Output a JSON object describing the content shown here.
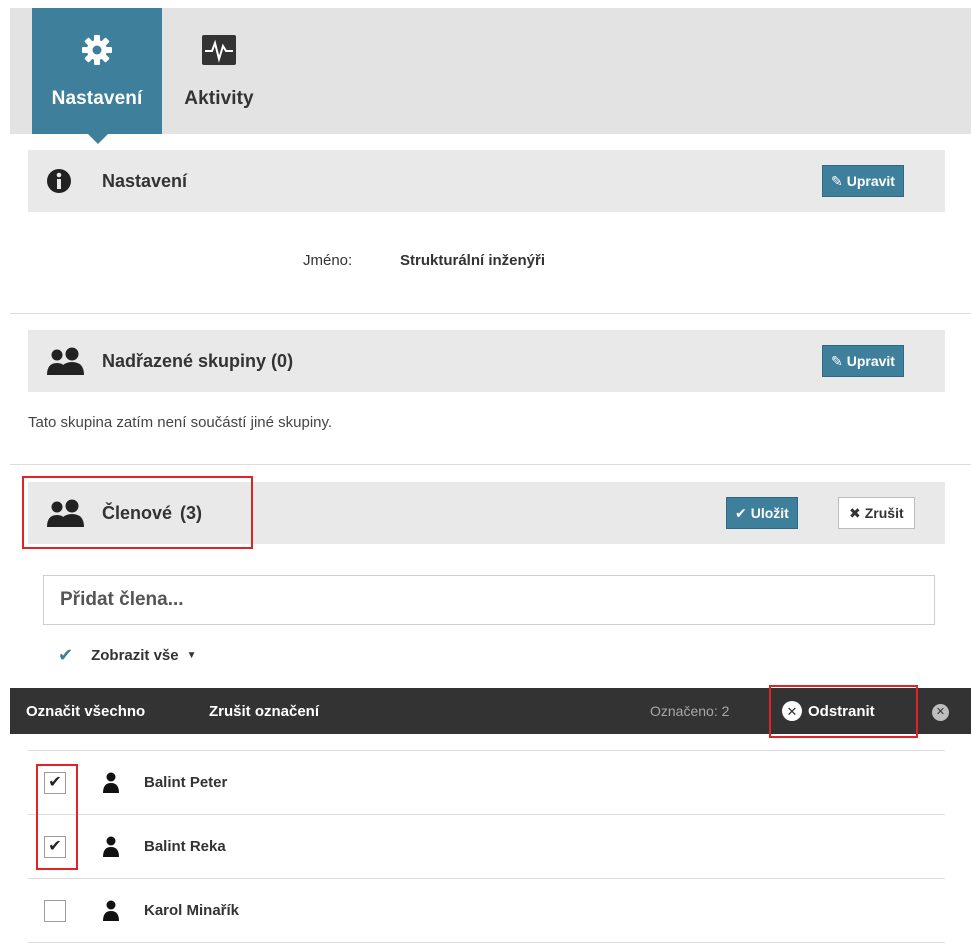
{
  "tabs": [
    {
      "label": "Nastavení",
      "icon": "gear-icon",
      "active": true
    },
    {
      "label": "Aktivity",
      "icon": "activity-monitor-icon",
      "active": false
    }
  ],
  "settings_panel": {
    "title": "Nastavení",
    "icon": "info-icon",
    "edit_label": "Upravit",
    "name_label": "Jméno:",
    "name_value": "Strukturální inženýři"
  },
  "parent_groups_panel": {
    "title": "Nadřazené skupiny (0)",
    "icon": "users-icon",
    "edit_label": "Upravit",
    "empty_text": "Tato skupina zatím není součástí jiné skupiny."
  },
  "members_panel": {
    "title": "Členové",
    "count": "(3)",
    "icon": "users-icon",
    "save_label": "Uložit",
    "cancel_label": "Zrušit",
    "add_placeholder": "Přidat člena...",
    "show_all_label": "Zobrazit vše"
  },
  "action_bar": {
    "select_all": "Označit všechno",
    "deselect": "Zrušit označení",
    "selected_count": "Označeno: 2",
    "remove_label": "Odstranit"
  },
  "members": [
    {
      "name": "Balint Peter",
      "checked": true
    },
    {
      "name": "Balint Reka",
      "checked": true
    },
    {
      "name": "Karol Minařík",
      "checked": false
    }
  ],
  "colors": {
    "accent": "#3e7f9b",
    "action_bar": "#333333",
    "highlight": "#e02424"
  }
}
